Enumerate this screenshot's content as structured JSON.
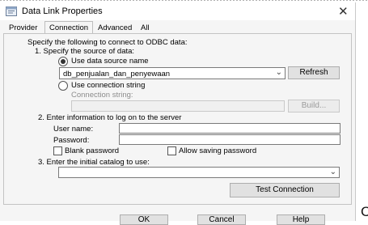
{
  "window": {
    "title": "Data Link Properties",
    "close_glyph": "✕"
  },
  "tabs": [
    {
      "label": "Provider",
      "active": false
    },
    {
      "label": "Connection",
      "active": true
    },
    {
      "label": "Advanced",
      "active": false
    },
    {
      "label": "All",
      "active": false
    }
  ],
  "connection": {
    "intro": "Specify the following to connect to ODBC data:",
    "step1": "1. Specify the source of data:",
    "use_dsn_label": "Use data source name",
    "dsn_value": "db_penjualan_dan_penyewaan",
    "refresh_label": "Refresh",
    "use_conn_string_label": "Use connection string",
    "conn_string_label": "Connection string:",
    "build_label": "Build...",
    "step2": "2. Enter information to log on to the server",
    "username_label": "User name:",
    "username_value": "",
    "password_label": "Password:",
    "password_value": "",
    "blank_password_label": "Blank password",
    "allow_saving_label": "Allow saving password",
    "step3": "3. Enter the initial catalog to use:",
    "catalog_value": "",
    "test_connection_label": "Test Connection"
  },
  "footer": {
    "ok_label": "OK",
    "cancel_label": "Cancel",
    "help_label": "Help"
  },
  "edge_glyph": "C"
}
